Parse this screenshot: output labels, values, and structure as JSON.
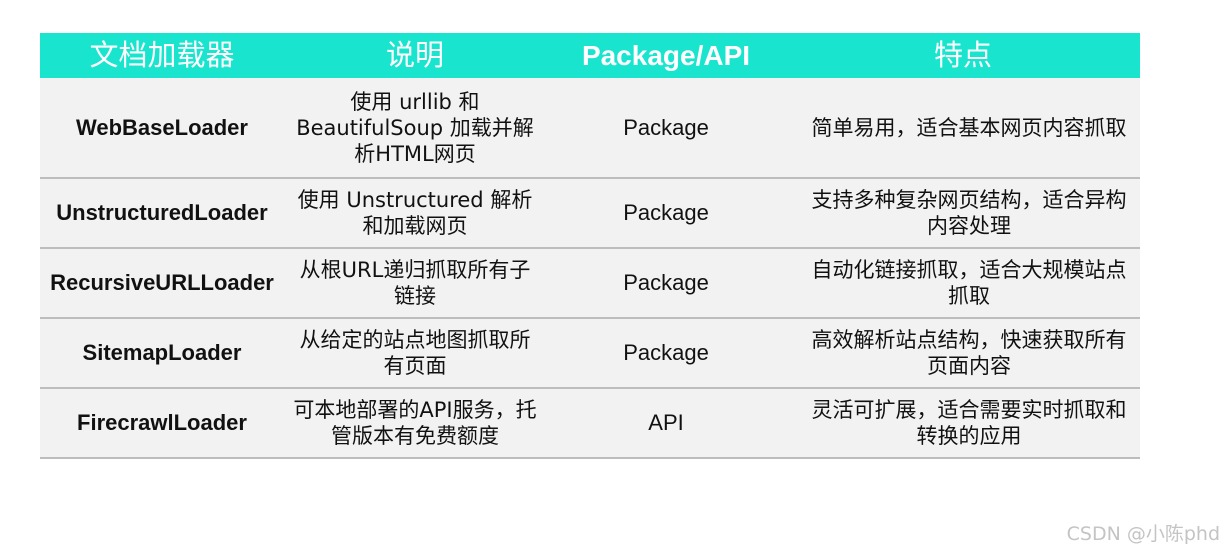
{
  "table": {
    "headers": [
      "文档加载器",
      "说明",
      "Package/API",
      "特点"
    ],
    "rows": [
      {
        "loader": "WebBaseLoader",
        "description": "使用 urllib 和 BeautifulSoup 加载并解析HTML网页",
        "package_api": "Package",
        "features": "简单易用，适合基本网页内容抓取"
      },
      {
        "loader": "UnstructuredLoader",
        "description": "使用 Unstructured 解析和加载网页",
        "package_api": "Package",
        "features": "支持多种复杂网页结构，适合异构内容处理"
      },
      {
        "loader": "RecursiveURLLoader",
        "description": "从根URL递归抓取所有子链接",
        "package_api": "Package",
        "features": "自动化链接抓取，适合大规模站点抓取"
      },
      {
        "loader": "SitemapLoader",
        "description": "从给定的站点地图抓取所有页面",
        "package_api": "Package",
        "features": "高效解析站点结构，快速获取所有页面内容"
      },
      {
        "loader": "FirecrawlLoader",
        "description": "可本地部署的API服务，托管版本有免费额度",
        "package_api": "API",
        "features": "灵活可扩展，适合需要实时抓取和转换的应用"
      }
    ]
  },
  "watermark": "CSDN @小陈phd",
  "colors": {
    "header_bg": "#19e5cf",
    "header_text": "#ffffff",
    "row_bg": "#f2f2f2",
    "row_border": "#bdbdbd"
  }
}
